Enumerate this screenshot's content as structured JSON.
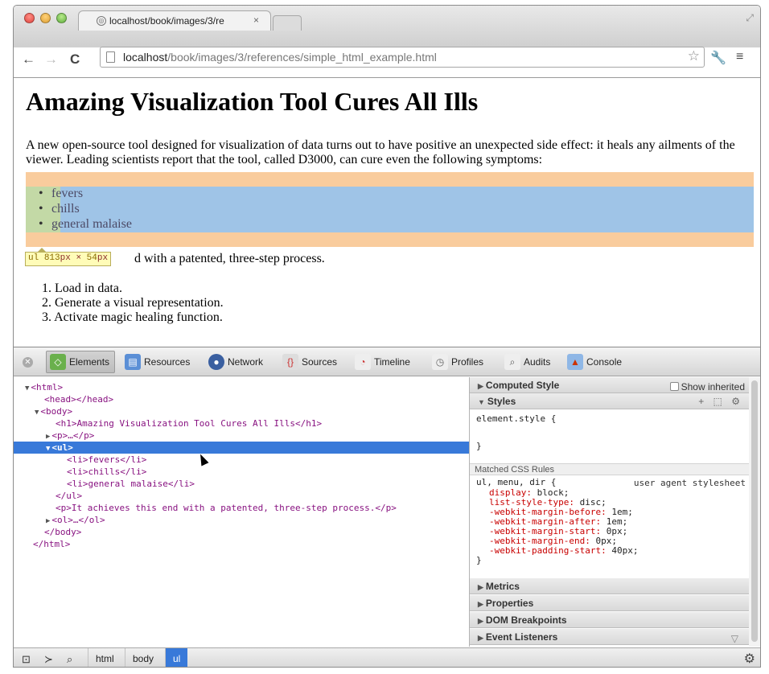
{
  "browser": {
    "tab_title": "localhost/book/images/3/re",
    "tab_close": "×",
    "url_host": "localhost",
    "url_path": "/book/images/3/references/simple_html_example.html",
    "back_glyph": "←",
    "forward_glyph": "→",
    "reload_glyph": "C",
    "star_glyph": "☆",
    "wrench_glyph": "🔧",
    "menu_glyph": "≡",
    "globe_glyph": "◎"
  },
  "page": {
    "heading": "Amazing Visualization Tool Cures All Ills",
    "intro": "A new open-source tool designed for visualization of data turns out to have positive an unexpected side effect: it heals any ailments of the viewer. Leading scientists report that the tool, called D3000, can cure even the following symptoms:",
    "list_items": [
      "fevers",
      "chills",
      "general malaise"
    ],
    "tooltip_tag": "ul",
    "tooltip_w": "813",
    "tooltip_h": "54",
    "tooltip_unit": "px",
    "tooltip_times": "×",
    "paragraph_visible": "d with a patented, three-step process.",
    "ordered_items": [
      "1.  Load in data.",
      "2.  Generate a visual representation.",
      "3.  Activate magic healing function."
    ]
  },
  "devtools": {
    "tabs": [
      {
        "label": "Elements",
        "icon": "elements-icon",
        "active": true
      },
      {
        "label": "Resources",
        "icon": "resources-icon"
      },
      {
        "label": "Network",
        "icon": "network-icon"
      },
      {
        "label": "Sources",
        "icon": "sources-icon"
      },
      {
        "label": "Timeline",
        "icon": "timeline-icon"
      },
      {
        "label": "Profiles",
        "icon": "profiles-icon"
      },
      {
        "label": "Audits",
        "icon": "audits-icon"
      },
      {
        "label": "Console",
        "icon": "console-icon"
      }
    ],
    "dom": [
      {
        "text": "<html>",
        "tri": "▼"
      },
      {
        "text": "<head></head>",
        "tri": ""
      },
      {
        "text": "<body>",
        "tri": "▼"
      },
      {
        "text": "<h1>Amazing Visualization Tool Cures All Ills</h1>",
        "tri": ""
      },
      {
        "text": "<p>…</p>",
        "tri": "▶"
      },
      {
        "text": "<ul>",
        "tri": "▼"
      },
      {
        "text": "<li>fevers</li>",
        "tri": ""
      },
      {
        "text": "<li>chills</li>",
        "tri": ""
      },
      {
        "text": "<li>general malaise</li>",
        "tri": ""
      },
      {
        "text": "</ul>",
        "tri": ""
      },
      {
        "text": "<p>It achieves this end with a patented, three-step process.</p>",
        "tri": ""
      },
      {
        "text": "<ol>…</ol>",
        "tri": "▶"
      },
      {
        "text": "</body>",
        "tri": ""
      },
      {
        "text": "</html>",
        "tri": ""
      }
    ],
    "sidebar": {
      "computed_style": "Computed Style",
      "show_inherited": "Show inherited",
      "styles": "Styles",
      "styles_icons": "+ ⬚ ⚙",
      "element_style_open": "element.style {",
      "element_style_close": "}",
      "matched_css_rules": "Matched CSS Rules",
      "rule_selector": "ul, menu, dir {",
      "rule_source": "user agent stylesheet",
      "rule_close": "}",
      "properties": [
        {
          "name": "display",
          "value": "block;"
        },
        {
          "name": "list-style-type",
          "value": "disc;"
        },
        {
          "name": "-webkit-margin-before",
          "value": "1em;"
        },
        {
          "name": "-webkit-margin-after",
          "value": "1em;"
        },
        {
          "name": "-webkit-margin-start",
          "value": "0px;"
        },
        {
          "name": "-webkit-margin-end",
          "value": "0px;"
        },
        {
          "name": "-webkit-padding-start",
          "value": "40px;"
        }
      ],
      "metrics": "Metrics",
      "properties_section": "Properties",
      "dom_breakpoints": "DOM Breakpoints",
      "event_listeners": "Event Listeners"
    },
    "breadcrumbs": [
      "html",
      "body",
      "ul"
    ]
  }
}
